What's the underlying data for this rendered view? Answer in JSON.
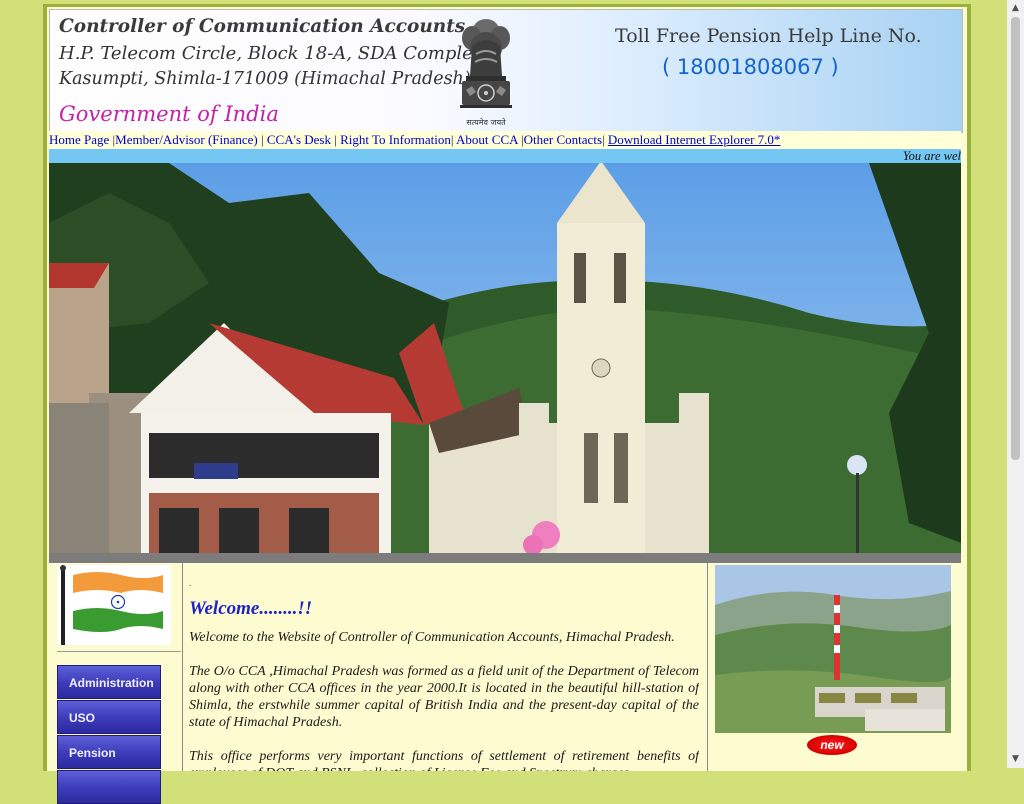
{
  "header": {
    "org_name": "Controller of Communication Accounts",
    "address_line1": "H.P. Telecom Circle, Block 18-A, SDA Complex",
    "address_line2": "Kasumpti, Shimla-171009 (Himachal Pradesh)",
    "government": "Government of India",
    "emblem_caption": "सत्यमेव जयते",
    "tollfree_label": "Toll Free Pension Help Line No.",
    "tollfree_number": "( 18001808067 )"
  },
  "nav": {
    "home": "Home Page",
    "member": "Member/Advisor (Finance)",
    "ccas_desk": "CCA's Desk",
    "rti": "Right To Information",
    "about": "About CCA",
    "other": "Other Contacts",
    "download_ie": "Download Internet Explorer 7.0*"
  },
  "ticker": {
    "text": "You are wel"
  },
  "sidebar": {
    "items": [
      {
        "label": "Administration"
      },
      {
        "label": "USO"
      },
      {
        "label": "Pension"
      }
    ]
  },
  "content": {
    "dot": ".",
    "welcome_title": "Welcome........!!",
    "welcome_sub": "Welcome to the Website of Controller of Communication Accounts, Himachal Pradesh.",
    "para1": "The O/o CCA ,Himachal Pradesh was formed as a field unit of the Department of Telecom along with other CCA offices in the year 2000.It is located in the beautiful hill-station of Shimla, the erstwhile summer capital of British India and the present-day capital of the state of Himachal Pradesh.",
    "para2": "This office performs very important functions of settlement of retirement benefits of employees of DOT and BSNL, collection of License Fee and Spectrum charges"
  },
  "rightcol": {
    "badge": "new"
  },
  "colors": {
    "page_bg": "#d2e07a",
    "content_bg": "#fdfbd0",
    "nav_link": "#0000cc",
    "sidebar_button": "#3c3ab9",
    "welcome": "#1e23c8",
    "goi": "#c420a8",
    "tollfree_number": "#1565c6",
    "ticker_bg": "#73c7f2"
  },
  "icons": {
    "emblem": "national-emblem-icon",
    "flag": "indian-flag-icon",
    "badge": "new-badge-icon"
  }
}
